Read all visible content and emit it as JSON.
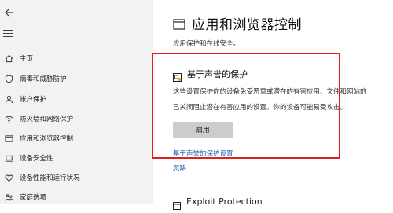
{
  "sidebar": {
    "items": [
      {
        "label": "主页",
        "icon": "home-icon"
      },
      {
        "label": "病毒和威胁防护",
        "icon": "shield-icon"
      },
      {
        "label": "帐户保护",
        "icon": "person-icon"
      },
      {
        "label": "防火墙和网络保护",
        "icon": "wifi-icon"
      },
      {
        "label": "应用和浏览器控制",
        "icon": "app-window-icon"
      },
      {
        "label": "设备安全性",
        "icon": "laptop-icon"
      },
      {
        "label": "设备性能和运行状况",
        "icon": "heart-icon"
      },
      {
        "label": "家庭选项",
        "icon": "family-icon"
      }
    ]
  },
  "main": {
    "title": "应用和浏览器控制",
    "subtitle": "应用保护和在线安全。",
    "section": {
      "heading": "基于声誉的保护",
      "desc1": "这些设置保护你的设备免受恶意或潜在的有害应用、文件和网站的",
      "desc2": "已关闭阻止潜在有害应用的设置。你的设备可能易受攻击。",
      "button": "启用",
      "link_settings": "基于声誉的保护设置",
      "link_ignore": "忽略"
    },
    "next_section_title": "Exploit Protection"
  },
  "colors": {
    "highlight_border": "#e02020",
    "link": "#1a5fb4",
    "sidebar_bg": "#f2f2f2",
    "button_bg": "#cccccc"
  }
}
